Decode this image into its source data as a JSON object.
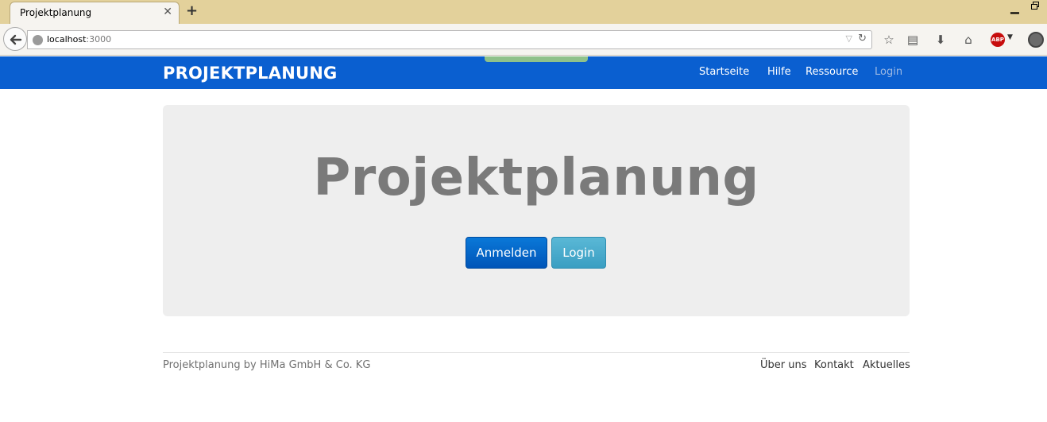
{
  "browser": {
    "tab_title": "Projektplanung",
    "tab_close": "✕",
    "new_tab": "+",
    "url_host": "localhost",
    "url_port": ":3000",
    "abp_label": "ABP",
    "icons": [
      "back-arrow-icon",
      "globe-icon",
      "reload-icon",
      "bookmark-star-icon",
      "reading-list-icon",
      "download-icon",
      "home-icon",
      "adblock-icon",
      "extension-reel-icon"
    ]
  },
  "site": {
    "brand": "PROJEKTPLANUNG",
    "nav": [
      "Startseite",
      "Hilfe",
      "Ressource",
      "Login"
    ],
    "nav_active": "Login",
    "colors": {
      "navbar": "#0a5fd0",
      "jumbotron": "#eeeeee",
      "primary": "#0a6fd0",
      "info": "#46aacc"
    }
  },
  "hero": {
    "title": "Projektplanung",
    "btn_register": "Anmelden",
    "btn_login": "Login"
  },
  "footer": {
    "copyright": "Projektplanung by HiMa GmbH & Co. KG",
    "links": [
      "Über uns",
      "Kontakt",
      "Aktuelles"
    ]
  }
}
